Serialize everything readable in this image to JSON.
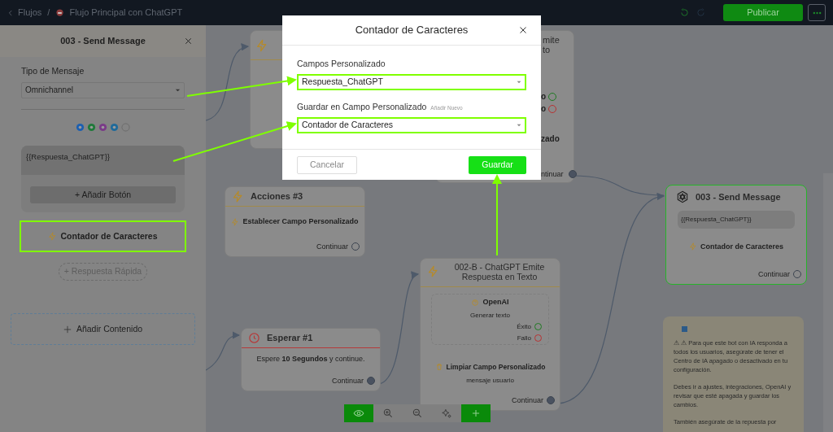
{
  "top_bar": {
    "breadcrumb": [
      {
        "label": "Flujos"
      },
      {
        "label": "Flujo Principal con ChatGPT"
      }
    ],
    "separator": "/",
    "publish_button": "Publicar"
  },
  "sidebar": {
    "title": "003 - Send Message",
    "message_type_label": "Tipo de Mensaje",
    "message_type_value": "Omnichannel",
    "channels": [
      {
        "kind": "messenger"
      },
      {
        "kind": "whatsapp"
      },
      {
        "kind": "instagram"
      },
      {
        "kind": "telegram"
      },
      {
        "kind": "chat"
      }
    ],
    "message_text": "{{Respuesta_ChatGPT}}",
    "add_button": "+ Añadir Botón",
    "action": {
      "label": "Contador de Caracteres",
      "highlighted": true
    },
    "quick_reply": "+ Respuesta Rápida",
    "add_content": "Añadir Contenido"
  },
  "canvas": {
    "nodes": [
      {
        "kind": "blank"
      },
      {
        "kind": "partial",
        "fragments": [
          {
            "kind": "title",
            "text": "mite"
          },
          {
            "kind": "title",
            "text": "to"
          },
          {
            "kind": "success",
            "text": "o"
          },
          {
            "kind": "failure",
            "text": "o"
          },
          {
            "kind": "label",
            "text": "zado"
          },
          {
            "kind": "continue",
            "text": "ntinuar"
          }
        ]
      },
      {
        "kind": "action",
        "title": "Acciones #3",
        "action": "Establecer Campo Personalizado",
        "continue": {
          "label": "Continuar",
          "connected": false
        }
      },
      {
        "kind": "message",
        "title": "003 - Send Message",
        "selected": true,
        "message": "{{Respuesta_ChatGPT}}",
        "action": "Contador de Caracteres",
        "continue": {
          "label": "Continuar",
          "connected": false
        }
      },
      {
        "kind": "ai",
        "title": "002-B - ChatGPT Emite Respuesta en Texto",
        "provider": "OpenAI",
        "operation": "Generar texto",
        "outcomes": [
          {
            "kind": "success",
            "label": "Éxito"
          },
          {
            "kind": "failure",
            "label": "Fallo"
          }
        ],
        "action": "Limpiar Campo Personalizado",
        "action_detail": "mensaje usuario",
        "continue": {
          "label": "Continuar",
          "connected": true
        }
      },
      {
        "kind": "wait",
        "title": "Esperar #1",
        "text": "Espere **10 Segundos** y continue.",
        "continue": {
          "label": "Continuar",
          "connected": true
        }
      }
    ],
    "note": {
      "paragraphs": [
        "⚠ ⚠ Para que este bot con IA responda a todos los usuarios, asegúrate de tener el Centro de IA apagado o desactivado en tu configuración.",
        "Debes ir a ajustes, integraciones, OpenAI y revisar que esté apagada y guardar los cambios.",
        "También asegúrate de la repuesta por"
      ]
    },
    "toolbar": [
      {
        "kind": "eye",
        "highlighted": true
      },
      {
        "kind": "zoom-in",
        "highlighted": false
      },
      {
        "kind": "zoom-out",
        "highlighted": false
      },
      {
        "kind": "sparkle",
        "highlighted": false
      },
      {
        "kind": "plus",
        "highlighted": true
      }
    ]
  },
  "modal": {
    "title": "Contador de Caracteres",
    "fields": [
      {
        "label": "Campos Personalizado",
        "value": "Respuesta_ChatGPT"
      },
      {
        "label": "Guardar en Campo Personalizado",
        "link": "Añadir Nuevo",
        "value": "Contador de Caracteres"
      }
    ],
    "cancel_button": "Cancelar",
    "save_button": "Guardar"
  }
}
